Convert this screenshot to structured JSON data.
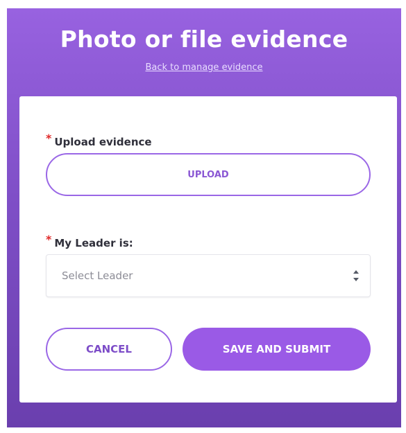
{
  "header": {
    "title": "Photo or file evidence",
    "back_link": "Back to manage evidence"
  },
  "form": {
    "upload": {
      "required_mark": "*",
      "label": "Upload evidence",
      "button_label": "UPLOAD"
    },
    "leader": {
      "required_mark": "*",
      "label": "My Leader is:",
      "placeholder": "Select Leader",
      "icon": "select-arrows-icon"
    },
    "actions": {
      "cancel_label": "CANCEL",
      "submit_label": "SAVE AND SUBMIT"
    }
  },
  "colors": {
    "background_top": "#9862e0",
    "background_bottom": "#6a3fae",
    "accent": "#9a5ae6",
    "required": "#e02a2a"
  }
}
